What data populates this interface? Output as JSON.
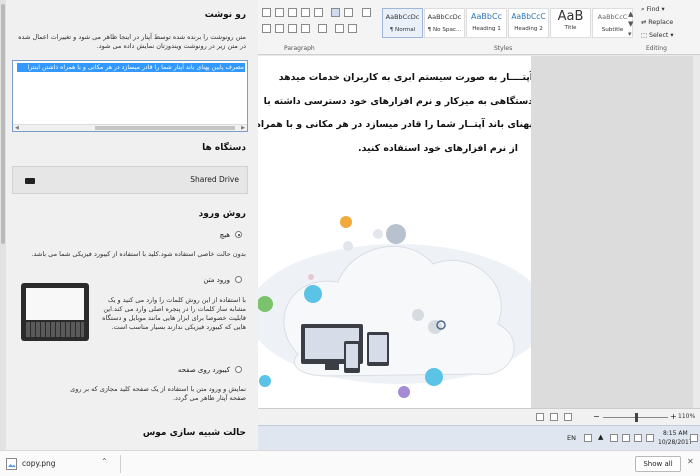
{
  "panel": {
    "clipboard_title": "رو نوشت",
    "clipboard_desc": "متن رونوشت را برنده شده توسط آپتار در اینجا ظاهر می شود و تغییرات اعمال شده در متن زیر در رونوشت ویندوزتان نمایش داده می شود.",
    "clipboard_text": "مصرف پایین پهنای باند آپتار شما را قادر میسازد در هر مکانی و با همراه داشتن اینترا",
    "devices_title": "دستگاه ها",
    "device_label": "Shared Drive",
    "input_title": "روش ورود",
    "opt_none_label": "هیچ",
    "opt_none_desc": "بدون حالت خاصی استفاده شود.کلید با استفاده از کیبورد فیزیکی شما می باشد.",
    "opt_text_label": "ورود متن",
    "opt_text_desc": "با استفاده از این روش کلمات را وارد می کنید و یک مشابه ساز کلمات را در پنجره اصلی وارد می کند.این قابلیت خصوصا برای ابزار هایی مانند موبایل و دستگاه هایی که کیبورد فیزیکی ندارند بسیار مناسب است.",
    "opt_screen_label": "کیبورد روی صفحه",
    "opt_screen_desc": "نمایش و ورود متن با استفاده از یک صفحه کلید مجازی که بر روی صفحه آپتار ظاهر می گردد.",
    "mouse_title": "حالت شبیه سازی موس"
  },
  "ribbon": {
    "paragraph_label": "Paragraph",
    "styles_label": "Styles",
    "editing_label": "Editing",
    "styles": [
      {
        "preview": "AaBbCcDc",
        "name": "¶ Normal"
      },
      {
        "preview": "AaBbCcDc",
        "name": "¶ No Spac..."
      },
      {
        "preview": "AaBbCc",
        "name": "Heading 1"
      },
      {
        "preview": "AaBbCcC",
        "name": "Heading 2"
      },
      {
        "preview": "AaB",
        "name": "Title"
      },
      {
        "preview": "AaBbCcC",
        "name": "Subtitle"
      }
    ],
    "find": "Find",
    "replace": "Replace",
    "select": "Select"
  },
  "document": {
    "lines": [
      "آپتــــار به صورت سیستم ابری به کاربران خدمات میدهد",
      "دستگاهی به میزکار و نرم افزارهای خود دسترسی داشته با",
      "پهنای باند آپتــار شما را قادر میسازد در هر مکانی و با همراه",
      "از نرم افزارهای خود استفاده کنید."
    ]
  },
  "status": {
    "zoom": "110%"
  },
  "taskbar": {
    "lang": "EN",
    "time": "8:15 AM",
    "date": "10/28/2017"
  },
  "download": {
    "filename": "copy.png",
    "show_all": "Show all"
  }
}
